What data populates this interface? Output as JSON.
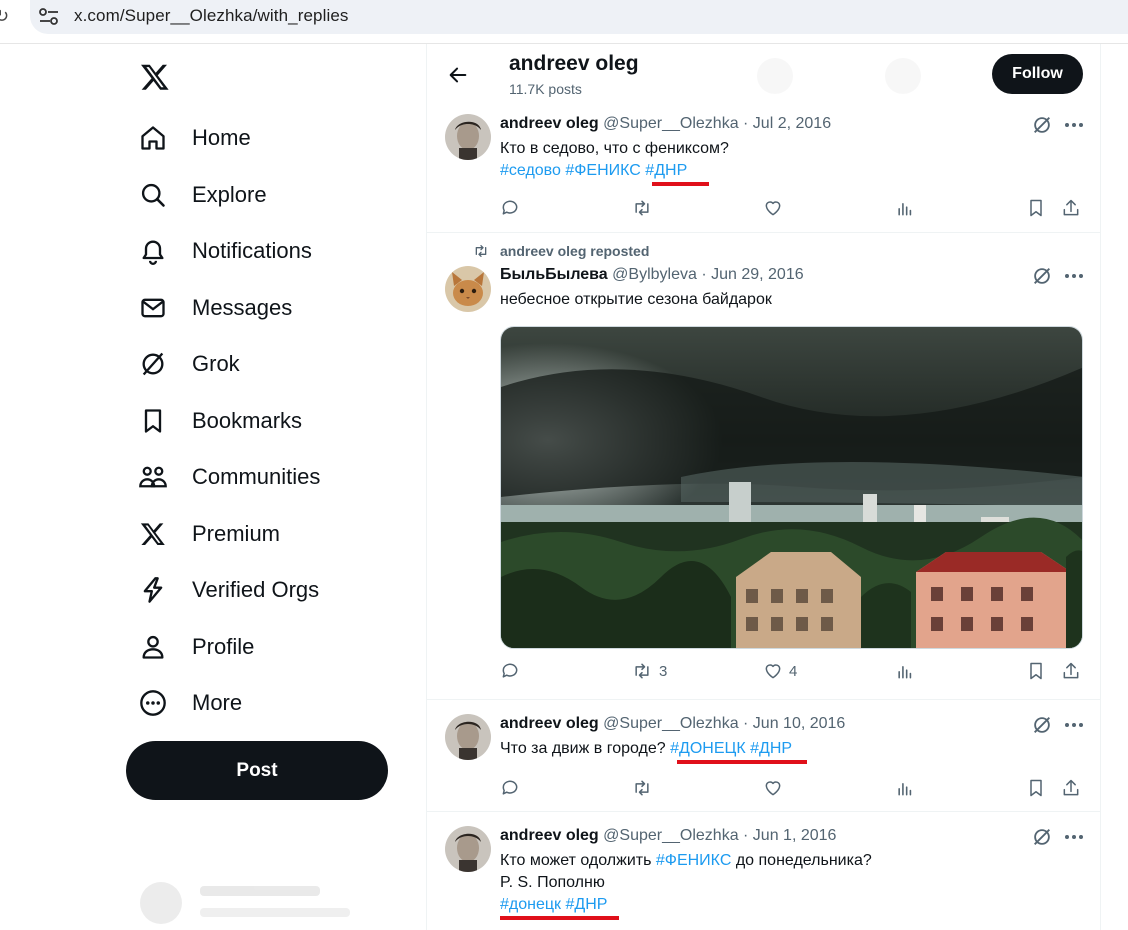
{
  "browser": {
    "url": "x.com/Super__Olezhka/with_replies"
  },
  "sidebar": {
    "items": [
      {
        "label": "Home",
        "icon": "home-icon"
      },
      {
        "label": "Explore",
        "icon": "search-icon"
      },
      {
        "label": "Notifications",
        "icon": "bell-icon"
      },
      {
        "label": "Messages",
        "icon": "envelope-icon"
      },
      {
        "label": "Grok",
        "icon": "grok-icon"
      },
      {
        "label": "Bookmarks",
        "icon": "bookmark-icon"
      },
      {
        "label": "Communities",
        "icon": "people-icon"
      },
      {
        "label": "Premium",
        "icon": "x-logo-icon"
      },
      {
        "label": "Verified Orgs",
        "icon": "lightning-icon"
      },
      {
        "label": "Profile",
        "icon": "person-icon"
      },
      {
        "label": "More",
        "icon": "more-circle-icon"
      }
    ],
    "post_label": "Post"
  },
  "header": {
    "name": "andreev oleg",
    "posts": "11.7K posts",
    "follow_label": "Follow"
  },
  "tweets": [
    {
      "name": "andreev oleg",
      "meta": "@Super__Olezhka · Jul 2, 2016",
      "line1_text": "Кто в седово, что с фениксом?",
      "tag1": "#седово",
      "tag2": "#ФЕНИКС",
      "tag3": "#ДНР"
    },
    {
      "repost_label": "andreev oleg reposted",
      "name": "БыльБылева",
      "meta": "@Bylbyleva · Jun 29, 2016",
      "text": "небесное открытие сезона байдарок",
      "reposts": "3",
      "likes": "4"
    },
    {
      "name": "andreev oleg",
      "meta": "@Super__Olezhka · Jun 10, 2016",
      "text_before": "Что за движ в городе? ",
      "tag1": "#ДОНЕЦК",
      "tag2": "#ДНР"
    },
    {
      "name": "andreev oleg",
      "meta": "@Super__Olezhka · Jun 1, 2016",
      "text_before": "Кто может одолжить ",
      "tag1": "#ФЕНИКС",
      "text_after": " до понедельника?",
      "line2": "P. S. Пополню",
      "tag2": "#донецк",
      "tag3": "#ДНР"
    }
  ],
  "colors": {
    "link": "#1d9bf0",
    "underline_annotation": "#e0101a",
    "button": "#0f1419"
  }
}
